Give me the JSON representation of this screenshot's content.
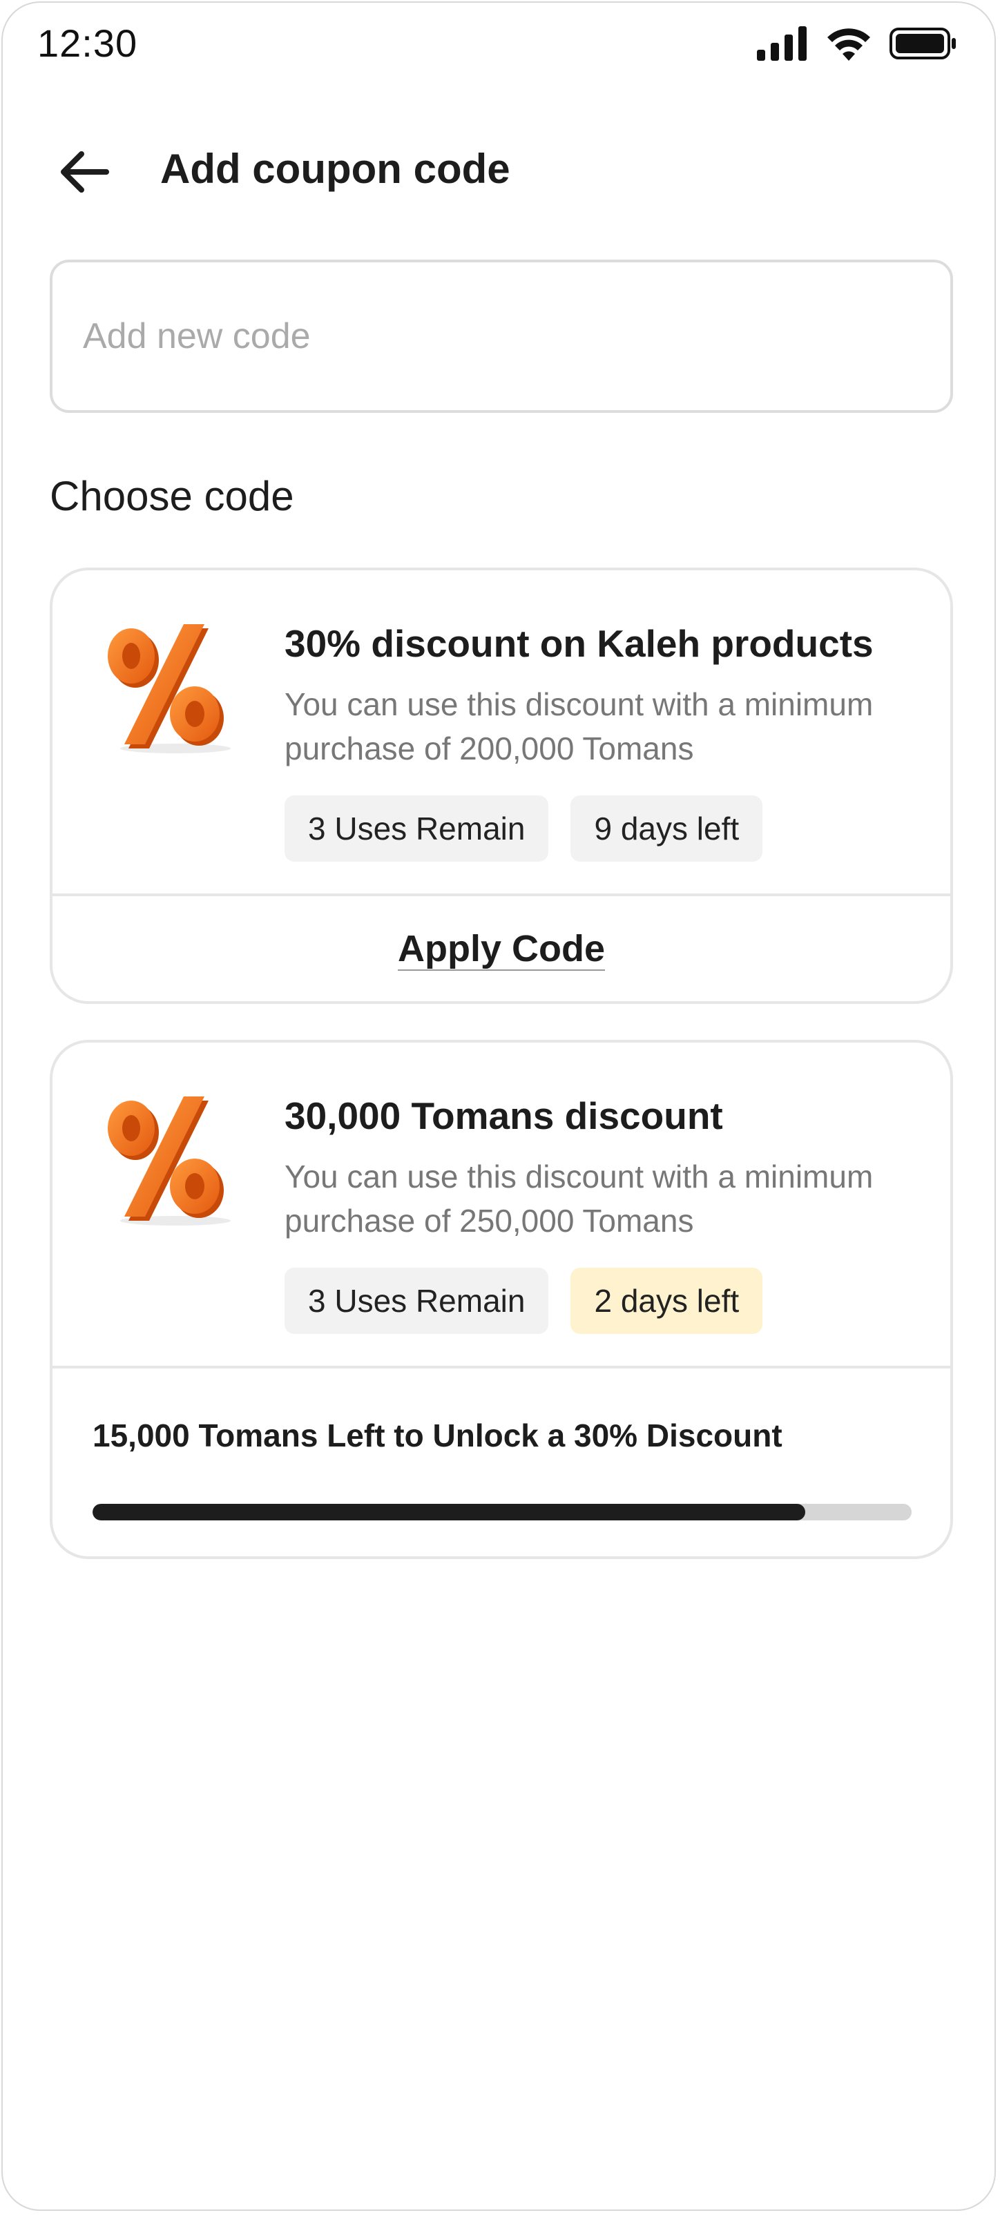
{
  "status_bar": {
    "time": "12:30",
    "signal_icon": "cellular-signal-icon",
    "wifi_icon": "wifi-icon",
    "battery_icon": "battery-icon"
  },
  "header": {
    "back_icon": "arrow-left-icon",
    "title": "Add coupon code"
  },
  "coupon_input": {
    "placeholder": "Add new code",
    "value": ""
  },
  "section_title": "Choose code",
  "coupons": [
    {
      "icon": "percent-3d-icon",
      "title": "30% discount on Kaleh products",
      "description": "You can use this discount with a minimum purchase of 200,000 Tomans",
      "uses": "3 Uses Remain",
      "days": "9 days left",
      "action_label": "Apply Code"
    },
    {
      "icon": "percent-3d-icon",
      "title": "30,000 Tomans discount",
      "description": "You can use this discount with a minimum purchase of 250,000 Tomans",
      "uses": "3 Uses Remain",
      "days": "2 days left",
      "progress_text": "15,000 Tomans Left to Unlock a 30% Discount",
      "progress_fraction": 0.87
    }
  ],
  "colors": {
    "icon_orange": "#f07a1f",
    "warning_chip": "#fff3cf",
    "progress_fill": "#1d1d1d",
    "progress_track": "#d6d6d6"
  }
}
